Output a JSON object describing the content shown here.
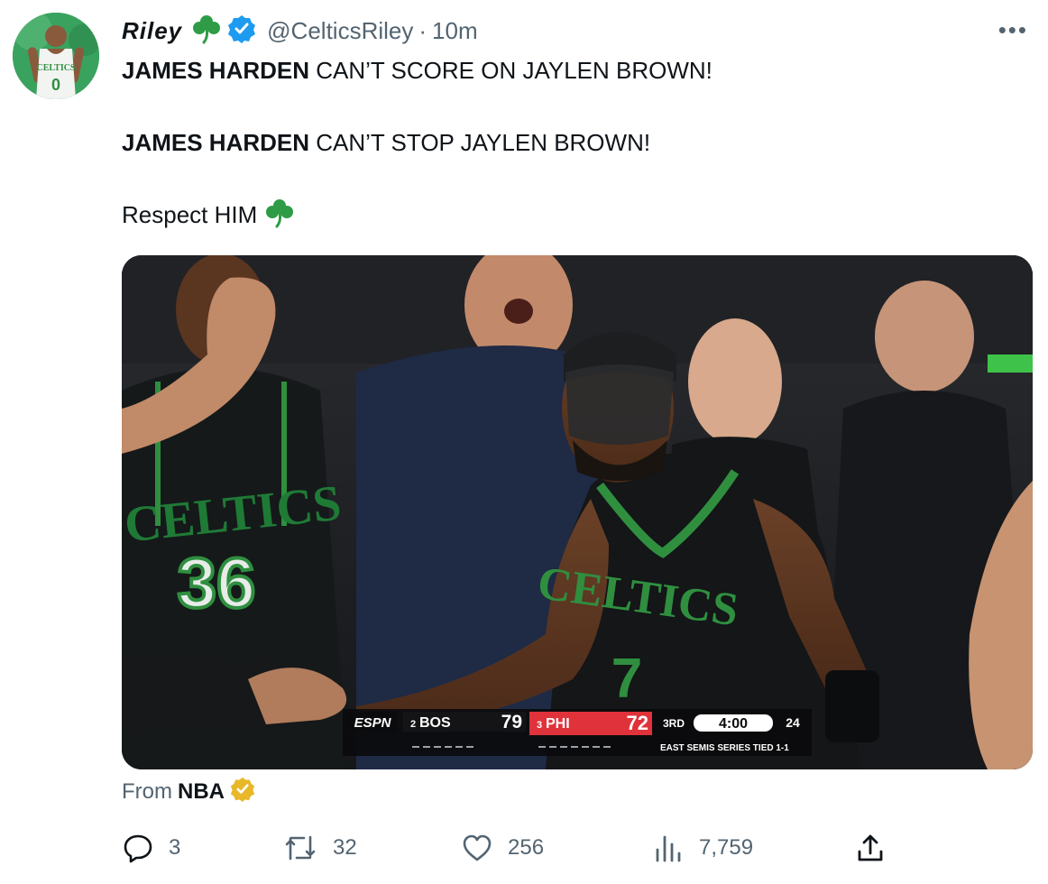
{
  "author": {
    "display_name": "Riley",
    "handle": "@CelticsRiley",
    "separator": "·",
    "time": "10m",
    "avatar_jersey_text": "CELTICS",
    "avatar_jersey_number": "0"
  },
  "more_label": "•••",
  "tweet": {
    "line1_bold": "JAMES HARDEN",
    "line1_rest": " CAN’T SCORE ON JAYLEN BROWN!",
    "line2_bold": "JAMES HARDEN",
    "line2_rest": " CAN’T STOP JAYLEN BROWN!",
    "line3": "Respect HIM"
  },
  "media": {
    "jersey_front_text": "CELTICS",
    "jersey_front_number": "7",
    "jersey_back_text": "CELTICS",
    "jersey_back_number": "36",
    "scorebug": {
      "network": "ESPN",
      "away_seed": "2",
      "away_team": "BOS",
      "away_score": "79",
      "home_seed": "3",
      "home_team": "PHI",
      "home_score": "72",
      "quarter": "3RD",
      "clock": "4:00",
      "shot_clock": "24",
      "series_text": "EAST SEMIS   SERIES TIED 1-1"
    }
  },
  "attribution": {
    "from_label": "From",
    "source": "NBA"
  },
  "actions": {
    "replies": "3",
    "retweets": "32",
    "likes": "256",
    "views": "7,759"
  },
  "colors": {
    "verified_blue": "#1d9bf0",
    "verified_gold": "#e8b829",
    "clover_green": "#2e9c46",
    "celtics_green": "#2f8f3f",
    "sixers_red": "#e0323a"
  },
  "icons": [
    "clover-icon",
    "verified-icon",
    "more-icon",
    "reply-icon",
    "retweet-icon",
    "like-icon",
    "views-icon",
    "share-icon",
    "gold-check-icon"
  ]
}
